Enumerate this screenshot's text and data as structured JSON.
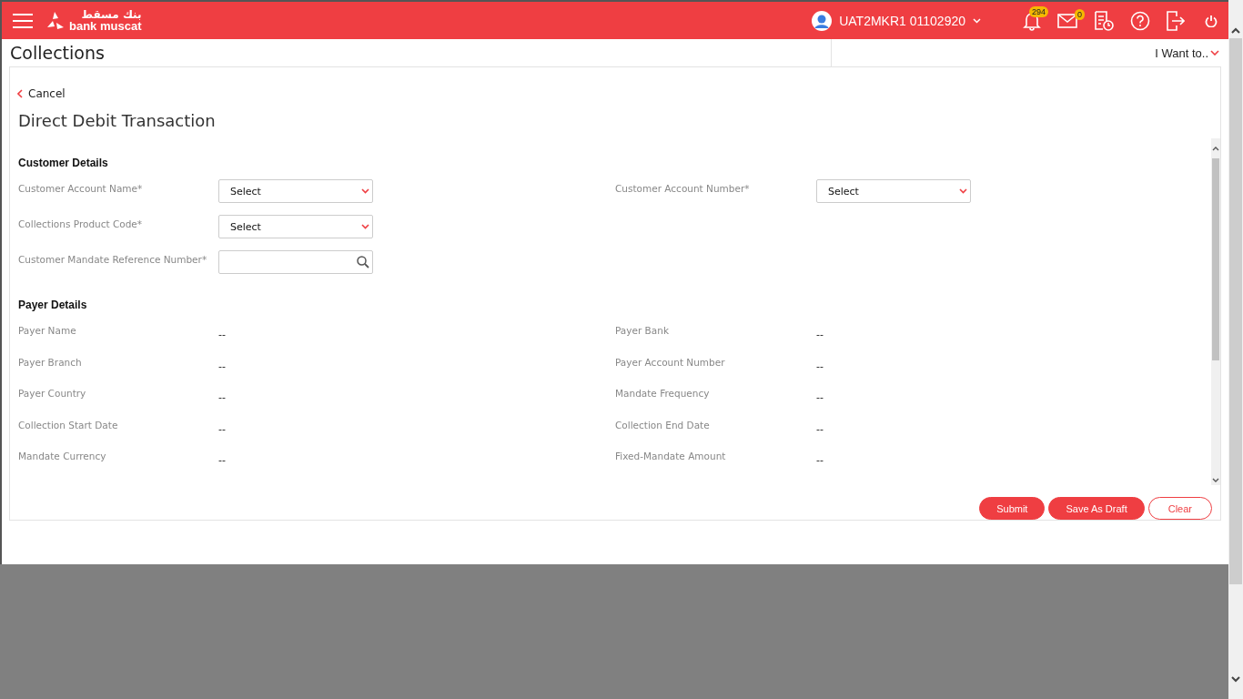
{
  "header": {
    "logo_arabic": "بنك مسقط",
    "logo_text": "bank muscat",
    "user": "UAT2MKR1 01102920",
    "notification_count": "294",
    "message_count": "0"
  },
  "page": {
    "title": "Collections",
    "menu": "I Want to.."
  },
  "form": {
    "back": "Cancel",
    "title": "Direct Debit Transaction",
    "sections": [
      {
        "title": "Customer Details",
        "rows": [
          [
            {
              "kind": "select",
              "label": "Customer Account Name*",
              "value": "Select"
            },
            {
              "kind": "select",
              "label": "Customer Account Number*",
              "value": "Select"
            }
          ],
          [
            {
              "kind": "select",
              "label": "Collections Product Code*",
              "value": "Select"
            }
          ],
          [
            {
              "kind": "search",
              "label": "Customer Mandate Reference Number*"
            }
          ]
        ]
      },
      {
        "title": "Payer Details",
        "rows": [
          [
            {
              "kind": "text",
              "label": "Payer Name",
              "value": "--"
            },
            {
              "kind": "text",
              "label": "Payer Bank",
              "value": "--"
            }
          ],
          [
            {
              "kind": "text",
              "label": "Payer Branch",
              "value": "--"
            },
            {
              "kind": "text",
              "label": "Payer Account Number",
              "value": "--"
            }
          ],
          [
            {
              "kind": "text",
              "label": "Payer Country",
              "value": "--"
            },
            {
              "kind": "text",
              "label": "Mandate Frequency",
              "value": "--"
            }
          ],
          [
            {
              "kind": "text",
              "label": "Collection Start Date",
              "value": "--"
            },
            {
              "kind": "text",
              "label": "Collection End Date",
              "value": "--"
            }
          ],
          [
            {
              "kind": "text",
              "label": "Mandate Currency",
              "value": "--"
            },
            {
              "kind": "text",
              "label": "Fixed-Mandate Amount",
              "value": "--"
            }
          ]
        ]
      }
    ],
    "buttons": [
      {
        "label": "Submit",
        "kind": "primary"
      },
      {
        "label": "Save As Draft",
        "kind": "primary"
      },
      {
        "label": "Clear",
        "kind": "secondary"
      }
    ]
  }
}
